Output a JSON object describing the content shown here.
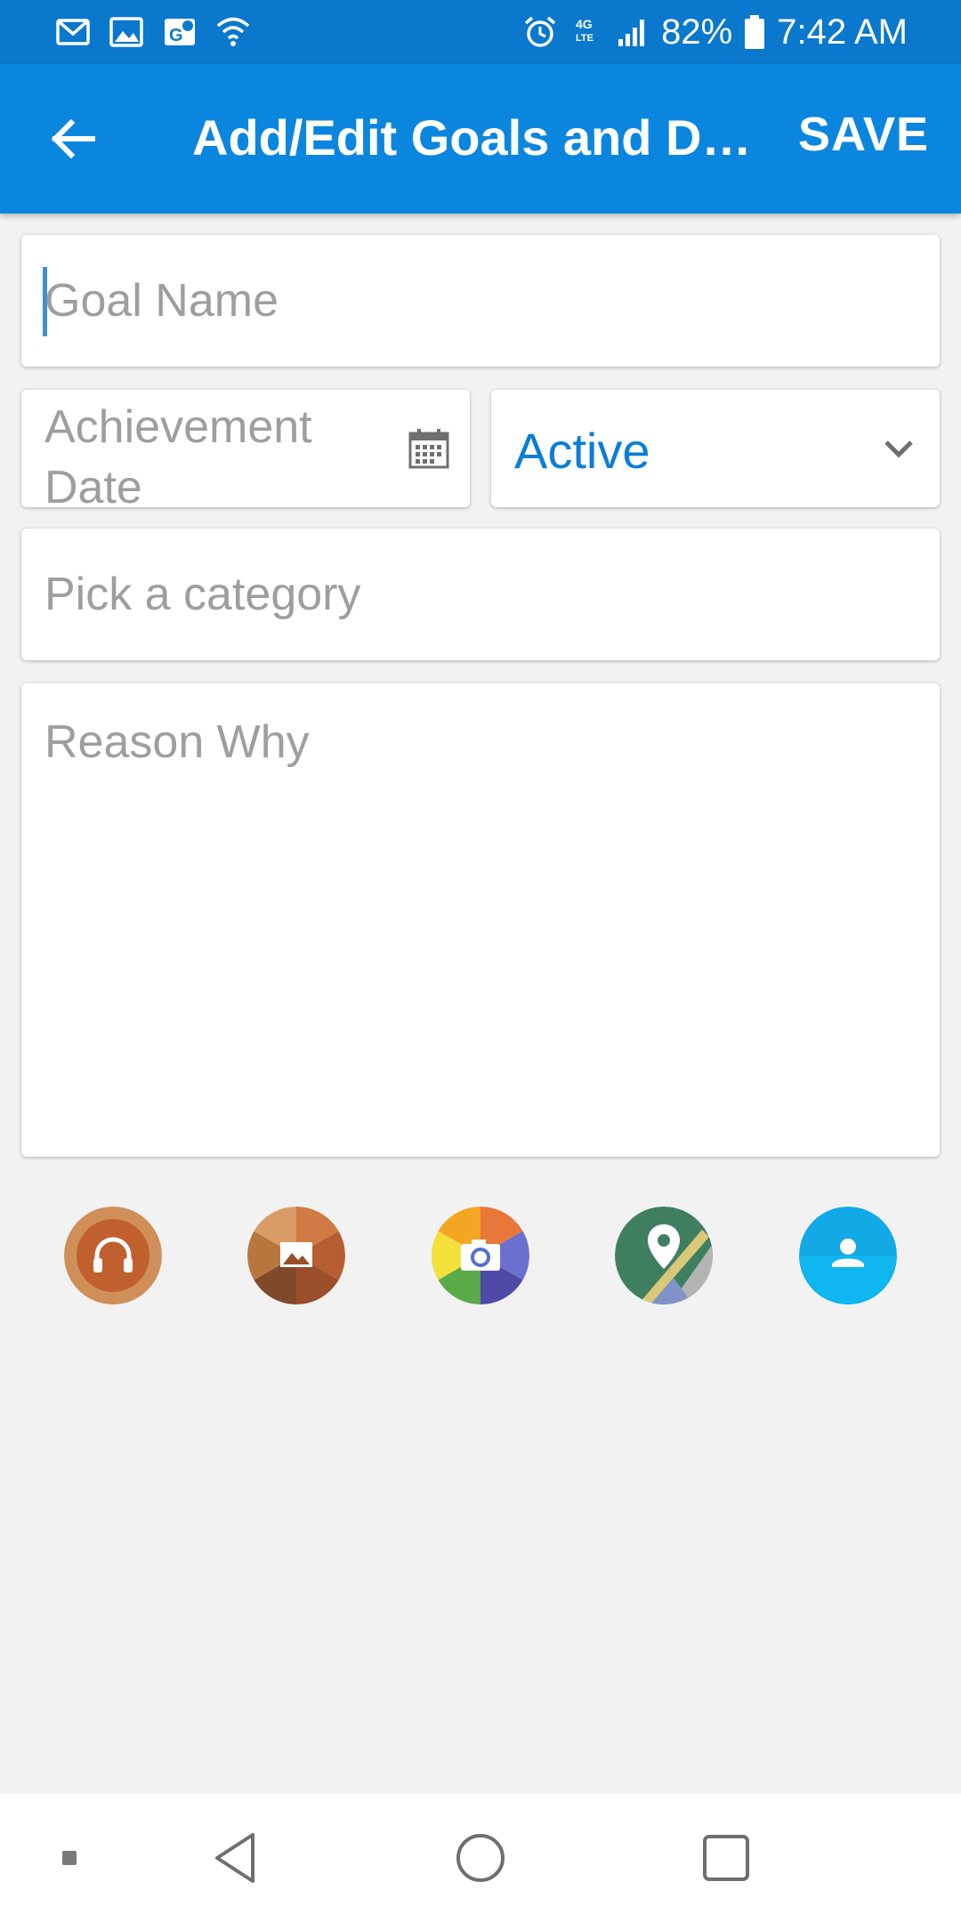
{
  "status_bar": {
    "battery": "82%",
    "time": "7:42 AM",
    "network": "4G LTE",
    "left_icons": [
      "gmail-icon",
      "image-icon",
      "maps-icon",
      "wifi-icon"
    ],
    "right_icons": [
      "alarm-icon",
      "lte-icon",
      "signal-icon",
      "battery-icon"
    ]
  },
  "app_bar": {
    "title": "Add/Edit Goals and Dr…",
    "save_label": "SAVE",
    "color": "#0b86df"
  },
  "form": {
    "goal_name_placeholder": "Goal Name",
    "achievement_date_placeholder": "Achievement Date",
    "status_value": "Active",
    "category_placeholder": "Pick a category",
    "reason_placeholder": "Reason Why"
  },
  "attachments": [
    "audio-icon",
    "gallery-icon",
    "camera-icon",
    "location-icon",
    "contact-icon"
  ],
  "nav": [
    "dot-indicator",
    "back",
    "home",
    "recents"
  ],
  "colors": {
    "accent": "#0b7dd6",
    "status_bar": "#0a78cd",
    "background": "#f2f2f2"
  }
}
